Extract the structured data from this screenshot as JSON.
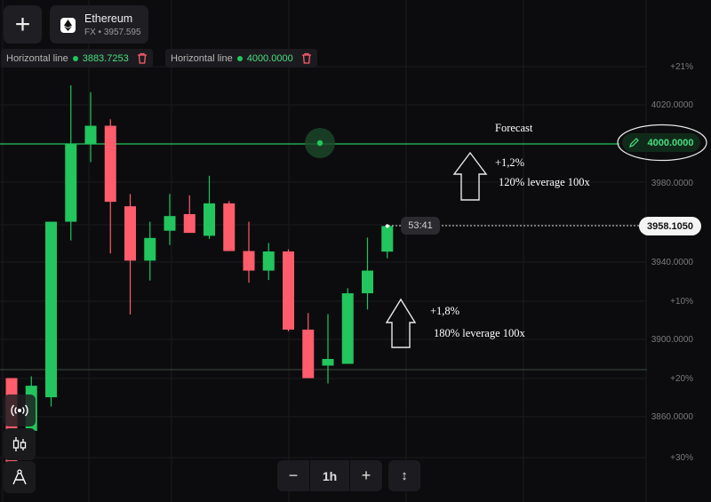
{
  "header": {
    "add_button_icon": "plus-icon",
    "asset": {
      "name": "Ethereum",
      "subtitle": "FX • 3957.595",
      "icon": "ethereum-logo-icon"
    }
  },
  "indicators": [
    {
      "label": "Horizontal line",
      "value": "3883.7253",
      "delete_icon": "trash-icon"
    },
    {
      "label": "Horizontal line",
      "value": "4000.0000",
      "delete_icon": "trash-icon"
    }
  ],
  "y_axis": {
    "prices": [
      "4020.0000",
      "3980.0000",
      "3940.0000",
      "3900.0000",
      "3860.0000"
    ],
    "percents": [
      "+21%",
      "+10%",
      "+20%",
      "+30%"
    ]
  },
  "tags": {
    "forecast_level": "4000.0000",
    "current_price": "3958.1050",
    "timer": "53:41"
  },
  "annotations": {
    "title": "Forecast",
    "upper_pct": "+1,2%",
    "upper_leverage": "120% leverage 100x",
    "lower_pct": "+1,8%",
    "lower_leverage": "180% leverage 100x"
  },
  "toolbar": {
    "minus": "−",
    "timeframe": "1h",
    "plus": "+",
    "scale": "↕"
  },
  "colors": {
    "up": "#22c55e",
    "down": "#ff5c6c",
    "background": "#0c0c0e",
    "level_line": "#22c55e"
  },
  "chart_data": {
    "type": "candlestick",
    "timeframe": "1h",
    "ylim": [
      3850,
      4025
    ],
    "horizontal_lines": [
      4000.0,
      3883.7253
    ],
    "current_price": 3958.105,
    "candles": [
      {
        "o": 3880.2,
        "h": 3880.2,
        "l": 3836.4,
        "c": 3836.4
      },
      {
        "o": 3853.2,
        "h": 3881.1,
        "l": 3853.2,
        "c": 3876.3
      },
      {
        "o": 3870.4,
        "h": 3960.2,
        "l": 3865.7,
        "c": 3960.2
      },
      {
        "o": 3960.2,
        "h": 4030.0,
        "l": 3950.6,
        "c": 4000.1
      },
      {
        "o": 4000.1,
        "h": 4026.5,
        "l": 3990.7,
        "c": 4009.3
      },
      {
        "o": 4009.3,
        "h": 4012.6,
        "l": 3944.0,
        "c": 3970.4
      },
      {
        "o": 3968.1,
        "h": 3974.4,
        "l": 3912.7,
        "c": 3940.3
      },
      {
        "o": 3940.3,
        "h": 3960.2,
        "l": 3930.1,
        "c": 3951.9
      },
      {
        "o": 3955.6,
        "h": 3974.4,
        "l": 3948.3,
        "c": 3963.1
      },
      {
        "o": 3964.1,
        "h": 3973.7,
        "l": 3954.5,
        "c": 3954.5
      },
      {
        "o": 3953.0,
        "h": 3983.7,
        "l": 3951.4,
        "c": 3969.6
      },
      {
        "o": 3969.6,
        "h": 3970.8,
        "l": 3945.2,
        "c": 3945.2
      },
      {
        "o": 3945.2,
        "h": 3960.2,
        "l": 3929.0,
        "c": 3935.2
      },
      {
        "o": 3935.2,
        "h": 3949.3,
        "l": 3930.4,
        "c": 3945.0
      },
      {
        "o": 3945.0,
        "h": 3946.1,
        "l": 3904.1,
        "c": 3905.0
      },
      {
        "o": 3905.0,
        "h": 3913.5,
        "l": 3880.2,
        "c": 3880.2
      },
      {
        "o": 3886.6,
        "h": 3912.9,
        "l": 3877.5,
        "c": 3890.0
      },
      {
        "o": 3887.5,
        "h": 3926.2,
        "l": 3887.5,
        "c": 3923.6
      },
      {
        "o": 3923.6,
        "h": 3952.1,
        "l": 3915.3,
        "c": 3935.2
      },
      {
        "o": 3944.9,
        "h": 3958.0,
        "l": 3941.5,
        "c": 3958.0
      }
    ]
  }
}
